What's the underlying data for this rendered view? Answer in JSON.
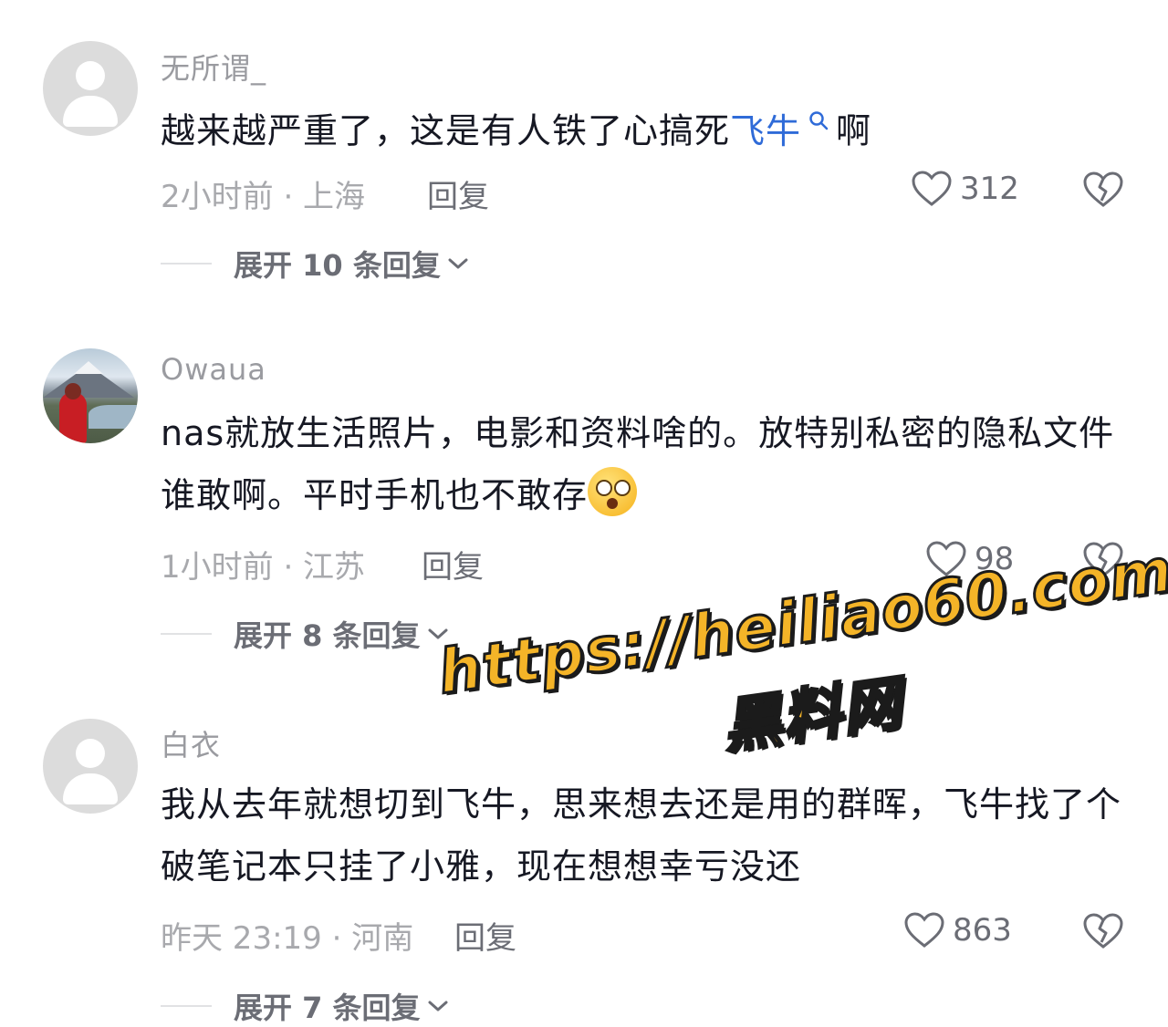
{
  "comments": [
    {
      "username": "无所谓_",
      "text_before": "越来越严重了，这是有人铁了心搞死",
      "text_link": "飞牛",
      "text_after": "啊",
      "time_location": "2小时前 · 上海",
      "reply_label": "回复",
      "likes": "312",
      "expand_label": "展开 10 条回复"
    },
    {
      "username": "Owaua",
      "text": "nas就放生活照片，电影和资料啥的。放特别私密的隐私文件谁敢啊。平时手机也不敢存",
      "time_location": "1小时前 · 江苏",
      "reply_label": "回复",
      "likes": "98",
      "expand_label": "展开 8 条回复"
    },
    {
      "username": "白衣",
      "text": "我从去年就想切到飞牛，思来想去还是用的群晖，飞牛找了个破笔记本只挂了小雅，现在想想幸亏没还",
      "time_location": "昨天 23:19 · 河南",
      "reply_label": "回复",
      "likes": "863",
      "expand_label": "展开 7 条回复"
    }
  ],
  "watermark": {
    "url": "https://heiliao60.com",
    "name": "黑料网"
  },
  "colors": {
    "link": "#2f6bd8",
    "meta": "#a8a9ad",
    "watermark_fill": "#f4b428"
  }
}
